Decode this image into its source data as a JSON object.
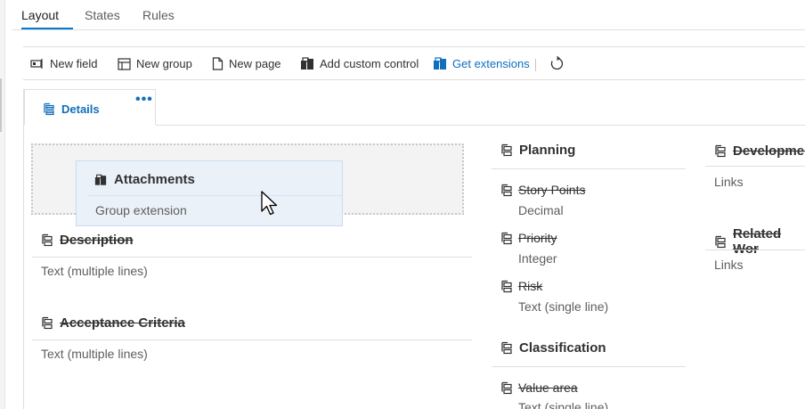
{
  "tabs": [
    {
      "label": "Layout",
      "active": true
    },
    {
      "label": "States",
      "active": false
    },
    {
      "label": "Rules",
      "active": false
    }
  ],
  "toolbar": {
    "new_field": "New field",
    "new_group": "New group",
    "new_page": "New page",
    "add_custom_control": "Add custom control",
    "get_extensions": "Get extensions",
    "refresh_icon": "refresh-icon"
  },
  "page_tab": {
    "label": "Details",
    "more": "•••"
  },
  "drag_card": {
    "title": "Attachments",
    "subtitle": "Group extension"
  },
  "left_column": [
    {
      "label": "Description",
      "type": "Text (multiple lines)"
    },
    {
      "label": "Acceptance Criteria",
      "type": "Text (multiple lines)"
    }
  ],
  "planning": {
    "title": "Planning",
    "fields": [
      {
        "label": "Story Points",
        "type": "Decimal"
      },
      {
        "label": "Priority",
        "type": "Integer"
      },
      {
        "label": "Risk",
        "type": "Text (single line)"
      }
    ]
  },
  "classification": {
    "title": "Classification",
    "fields": [
      {
        "label": "Value area",
        "type": "Text (single line)"
      }
    ]
  },
  "right_column": [
    {
      "label": "Developmer",
      "type": "Links"
    },
    {
      "label": "Related Wor",
      "type": "Links"
    }
  ],
  "colors": {
    "accent": "#0078d4",
    "link": "#106ebe",
    "drag_card_bg": "#eaf1f9"
  }
}
